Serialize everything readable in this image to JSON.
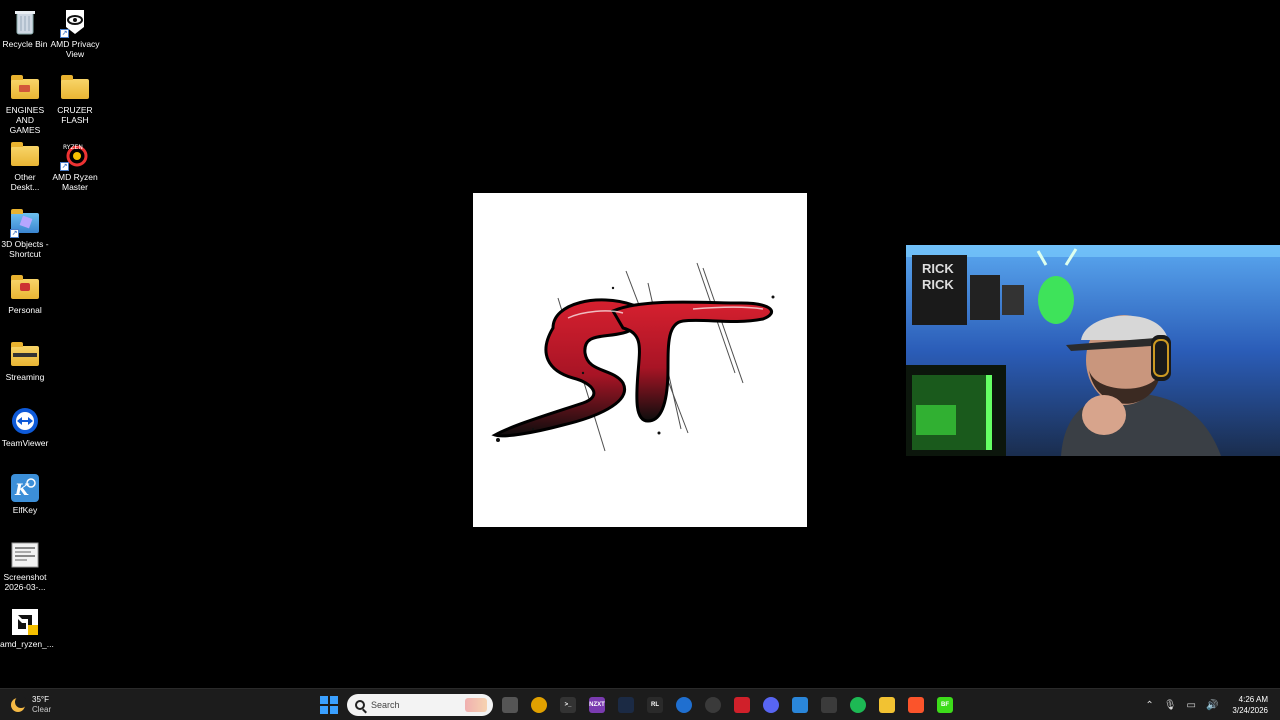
{
  "desktop": {
    "icons": [
      {
        "label": "Recycle Bin",
        "icon": "recycle-bin-icon"
      },
      {
        "label": "AMD Privacy\nView",
        "icon": "eye-icon"
      },
      {
        "label": "ENGINES\nAND GAMES",
        "icon": "folder-icon"
      },
      {
        "label": "CRUZER\nFLASH",
        "icon": "folder-icon"
      },
      {
        "label": "Other\nDeskt...",
        "icon": "folder-icon"
      },
      {
        "label": "AMD Ryzen\nMaster",
        "icon": "ryzen-icon"
      },
      {
        "label": "3D Objects -\nShortcut",
        "icon": "3d-objects-icon"
      },
      {
        "label": "Personal",
        "icon": "folder-icon"
      },
      {
        "label": "Streaming",
        "icon": "folder-icon"
      },
      {
        "label": "TeamViewer",
        "icon": "teamviewer-icon"
      },
      {
        "label": "ElfKey",
        "icon": "elfkey-icon"
      },
      {
        "label": "Screenshot\n2026-03-...",
        "icon": "document-icon"
      },
      {
        "label": "amd_ryzen_...",
        "icon": "amd-installer-icon"
      }
    ]
  },
  "logo_window": {
    "logo": "st-logo"
  },
  "webcam": {
    "text_on_wall": [
      "RICK",
      "RICK"
    ]
  },
  "taskbar": {
    "weather": {
      "temperature": "35°F",
      "condition": "Clear",
      "icon": "moon-icon"
    },
    "search_placeholder": "Search",
    "apps": [
      {
        "name": "task-view",
        "color": "#555555",
        "glyph": ""
      },
      {
        "name": "chrome",
        "color": "#e0a000",
        "glyph": ""
      },
      {
        "name": "terminal",
        "color": "#333333",
        "glyph": ">_"
      },
      {
        "name": "nzxt",
        "color": "#7a3bb0",
        "glyph": "NZXT"
      },
      {
        "name": "steam",
        "color": "#1b2a44",
        "glyph": ""
      },
      {
        "name": "rl",
        "color": "#2a2a2a",
        "glyph": "RL"
      },
      {
        "name": "app-blue",
        "color": "#1f6fd0",
        "glyph": ""
      },
      {
        "name": "app-gray",
        "color": "#3a3a3a",
        "glyph": ""
      },
      {
        "name": "amd",
        "color": "#d0202a",
        "glyph": ""
      },
      {
        "name": "discord",
        "color": "#5865f2",
        "glyph": ""
      },
      {
        "name": "photos",
        "color": "#2a86d9",
        "glyph": ""
      },
      {
        "name": "app-multi",
        "color": "#3b3b3b",
        "glyph": ""
      },
      {
        "name": "spotify",
        "color": "#1db954",
        "glyph": ""
      },
      {
        "name": "file-explorer",
        "color": "#f2c232",
        "glyph": ""
      },
      {
        "name": "brave",
        "color": "#fb542b",
        "glyph": ""
      },
      {
        "name": "bf",
        "color": "#3ddc1a",
        "glyph": "BF"
      }
    ],
    "tray": {
      "time": "4:26 AM",
      "date": "3/24/2026"
    }
  }
}
